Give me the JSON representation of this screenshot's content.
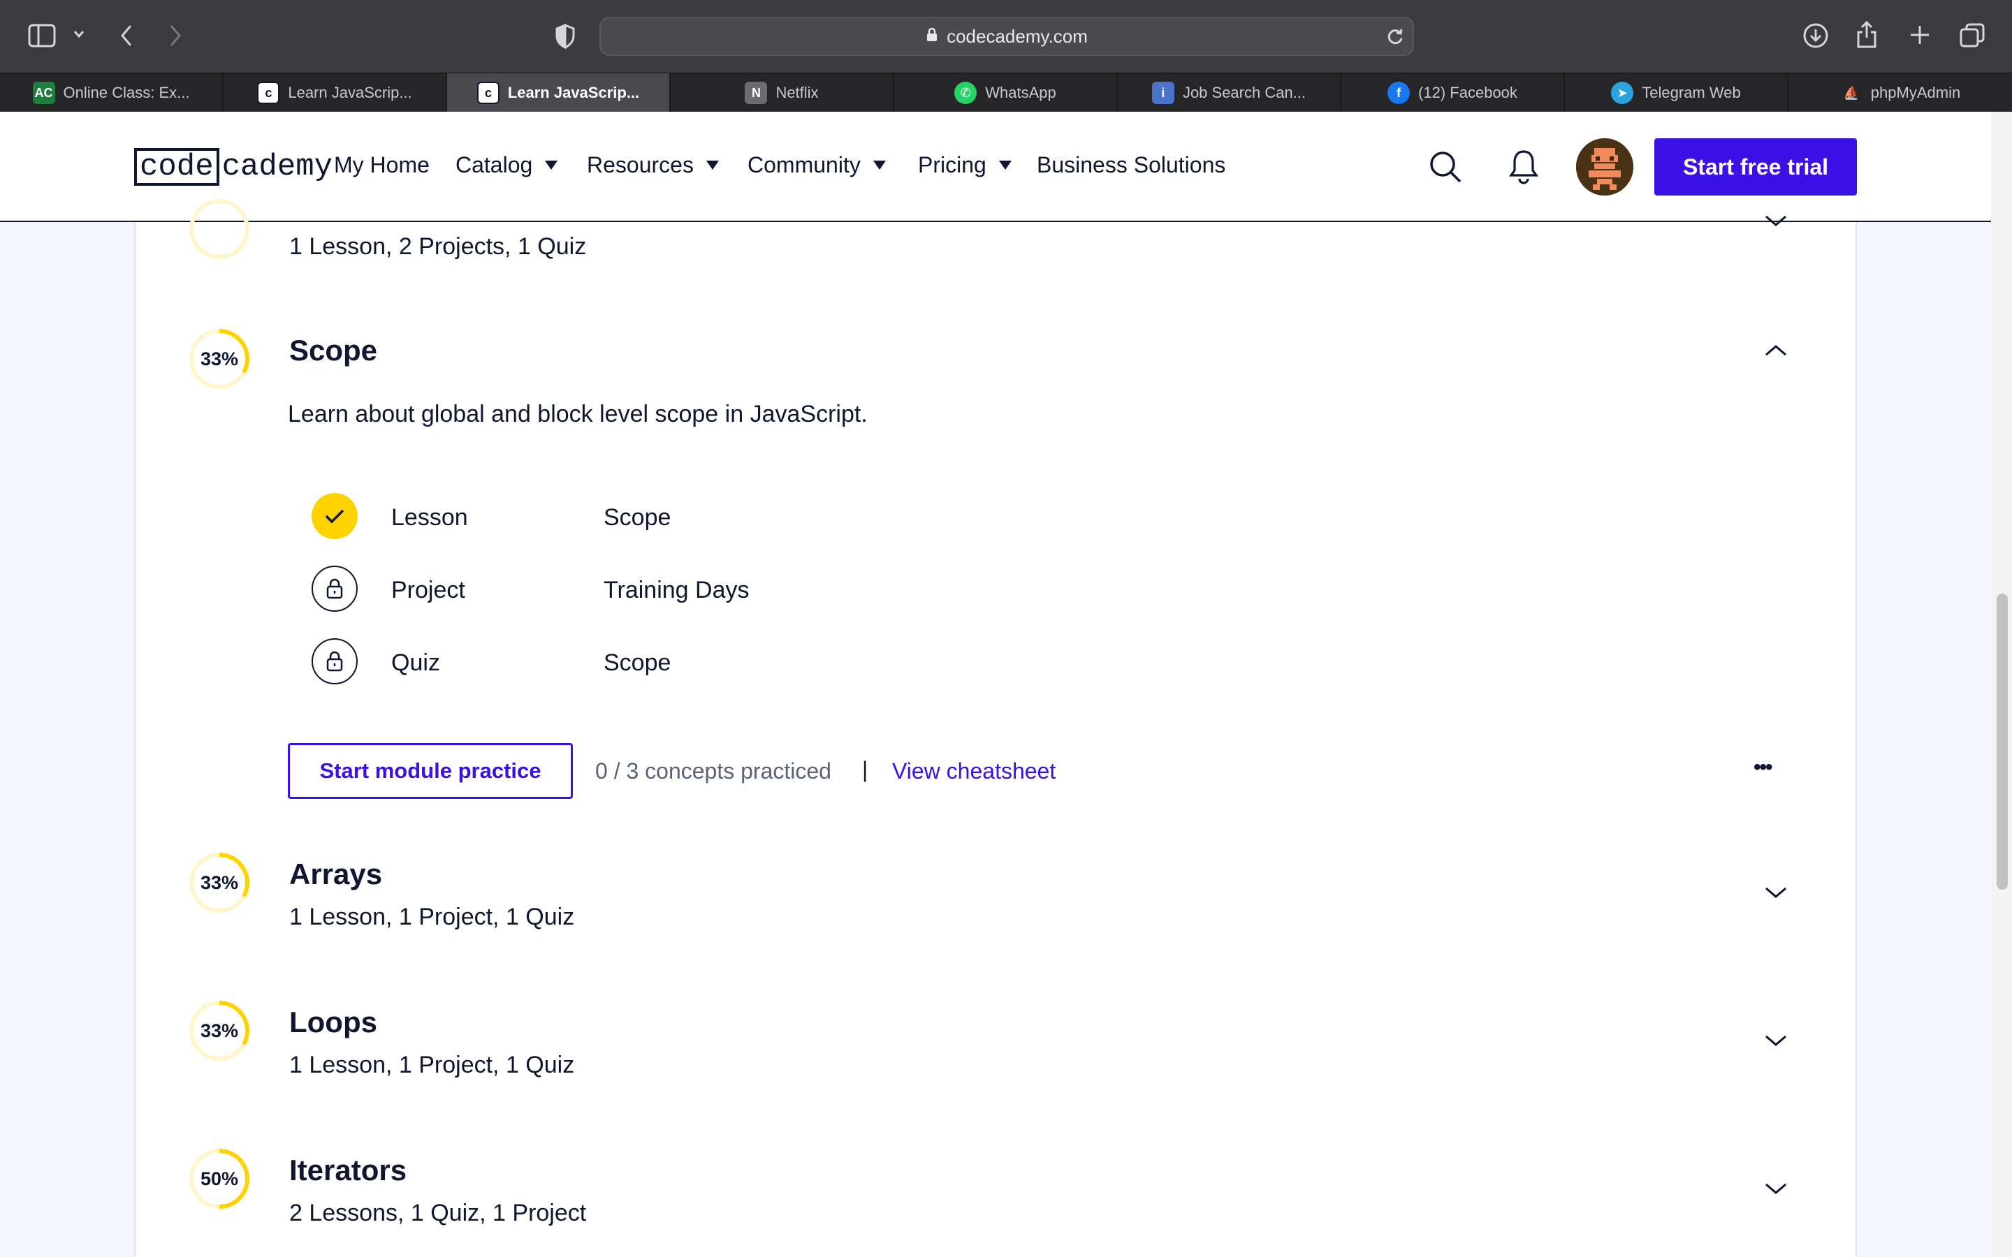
{
  "browser": {
    "url": "codecademy.com",
    "tabs": [
      {
        "label": "Online Class: Ex...",
        "favicon": "AC",
        "color": "#1e7e3e"
      },
      {
        "label": "Learn JavaScrip...",
        "favicon": "c",
        "color": "#3b3b3e"
      },
      {
        "label": "Learn JavaScrip...",
        "favicon": "c",
        "color": "#3b3b3e",
        "active": true
      },
      {
        "label": "Netflix",
        "favicon": "N",
        "color": "#6b6b70"
      },
      {
        "label": "WhatsApp",
        "favicon": "W",
        "color": "#25d366"
      },
      {
        "label": "Job Search Can...",
        "favicon": "i",
        "color": "#4a73c9"
      },
      {
        "label": "(12) Facebook",
        "favicon": "f",
        "color": "#1877f2"
      },
      {
        "label": "Telegram Web",
        "favicon": "T",
        "color": "#2aa3e0"
      },
      {
        "label": "phpMyAdmin",
        "favicon": "P",
        "color": "#e28a1e"
      }
    ]
  },
  "nav": {
    "logo_code": "code",
    "logo_rest": "cademy",
    "my_home": "My Home",
    "catalog": "Catalog",
    "resources": "Resources",
    "community": "Community",
    "pricing": "Pricing",
    "business": "Business Solutions",
    "cta": "Start free trial"
  },
  "colors": {
    "accent": "#3a10e5",
    "progress": "#ffd300",
    "navy": "#10162f"
  },
  "modules": {
    "previous": {
      "sub": "1 Lesson, 2 Projects, 1 Quiz"
    },
    "scope": {
      "percent": "33%",
      "progress": 0.33,
      "title": "Scope",
      "description": "Learn about global and block level scope in JavaScript.",
      "items": [
        {
          "type": "Lesson",
          "name": "Scope",
          "status": "completed"
        },
        {
          "type": "Project",
          "name": "Training Days",
          "status": "locked"
        },
        {
          "type": "Quiz",
          "name": "Scope",
          "status": "locked"
        }
      ],
      "practice_button": "Start module practice",
      "concepts": "0 / 3 concepts practiced",
      "separator": "|",
      "cheatsheet": "View cheatsheet",
      "more": "•••"
    },
    "arrays": {
      "percent": "33%",
      "progress": 0.33,
      "title": "Arrays",
      "sub": "1 Lesson, 1 Project, 1 Quiz"
    },
    "loops": {
      "percent": "33%",
      "progress": 0.33,
      "title": "Loops",
      "sub": "1 Lesson, 1 Project, 1 Quiz"
    },
    "iterators": {
      "percent": "50%",
      "progress": 0.5,
      "title": "Iterators",
      "sub": "2 Lessons, 1 Quiz, 1 Project"
    }
  }
}
